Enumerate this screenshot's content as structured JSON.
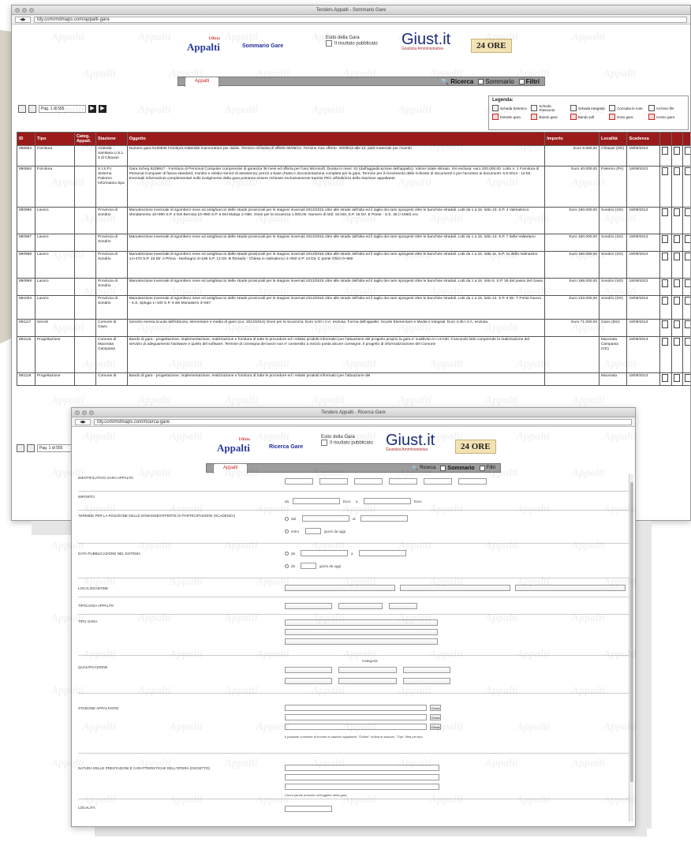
{
  "win1": {
    "title": "Tenders Appalti - Sommario Gare",
    "url": "tdy.com/mdmaps.com/appalti-gara",
    "header": {
      "logo": "Appalti",
      "logo_sub": "Ufficio",
      "sommario_link": "Sommario Gare",
      "esito_title": "Esito della Gara",
      "esito_sub": "Il risultato pubblicato",
      "giust": "Giust.it",
      "giust_sub": "Giustizia Amministrativa",
      "sole": "24 ORE",
      "tab_label": "Appalti",
      "ricerca": "Ricerca",
      "sommario": "Sommario",
      "filtri": "Filtri"
    },
    "pager": {
      "label": "Pag. 1 di 555"
    },
    "legend": {
      "title": "Legenda:",
      "items": [
        "Scheda Sintetica",
        "Scheda Riassunto",
        "Scheda Integrale",
        "Consulta le note",
        "Archivio file",
        "Estratto gara",
        "Bando gara",
        "Bando pdf",
        "Esito gara",
        "Avviso gara"
      ]
    },
    "table": {
      "headers": [
        "ID",
        "Tipo",
        "Categ. Appalt.",
        "Stazione",
        "Oggetto",
        "Importo",
        "Località",
        "Scadenza",
        "",
        "",
        ""
      ],
      "rows": [
        [
          "890854",
          "Fornitura",
          "",
          "Azienda Sanitaria U.S.L. 3 di Chiavari",
          "Numero gara 5190836 Fornitura materiale manovratore per dialisi. Termine richiesta di offerte 05/09/13. Termine max offerte: 30/09/13 alle 12. parti materiale per ricambi",
          "Euro 8.600,00",
          "Chiavari (GE)",
          "19/09/2013"
        ],
        [
          "890864",
          "Fornitura",
          "",
          "S.I.S.P.I. Sistema Palermo Informatica Spa",
          "Gara Scheg 5239917 - Fornitura di Personal Computer comprensivi di garanzia 36 mesi ed offerta per l'uso Microsoft. Durata in mesi: 42 (dall'aggiudicazione dell'appalto). Valore totale stimato, IVA esclusa: euro 200.000,00. Lotto n. 1 Fornitura di Personal Computer di fascia standard, monitor e relativi servizi di assistenza; prezzi a base d'asta e documentazione completa per la gara. Termine per il ricevimento delle richieste di documenti o per l'accesso ai documenti: 6.9.2013 - 12:00. Eventuali informazioni complementari sullo svolgimento della gara potranno essere richieste esclusivamente tramite PEC all'indirizzo della Stazione appaltante.",
          "Euro 40.000,00",
          "Palermo (PA)",
          "19/09/2013"
        ],
        [
          "890996",
          "Lavoro",
          "",
          "Provincia di Sondrio",
          "Manutenzione invernale di sgombero neve ed antighiaccio delle strade provinciali per le stagioni invernali 2013/2015 oltre alle strade dell'alta ed il taglio dei rami sporgenti oltre le banchine stradali. Lotti da 1 a 15. lotto 10. S.P. 4 Valmalenco sfondamento 10+990 S.P. 4 Del Bernina 10+990 S.P. 6 Del Maloja 1+090. Oneri per la sicurezza 1.000,00. Numero di lotti: 15 lotti. S.P. 15 Dir. E Ponte - S.S. 38 (+1960) ecc.",
          "Euro 180.000,00",
          "Sondrio (SO)",
          "19/09/2013"
        ],
        [
          "890997",
          "Lavoro",
          "",
          "Provincia di Sondrio",
          "Manutenzione invernale di sgombero neve ed antighiaccio delle strade provinciali per le stagioni invernali 2013/2015 oltre alle strade dell'alta ed il taglio dei rami sporgenti oltre le banchine stradali. Lotti da 1 a 15. lotto 13. S.P. 7 della Valtartano",
          "Euro 160.000,00",
          "Sondrio (SO)",
          "19/09/2013"
        ],
        [
          "890998",
          "Lavoro",
          "",
          "Provincia di Sondrio",
          "Manutenzione invernale di sgombero neve ed antighiaccio delle strade provinciali per le stagioni invernali 2013/2015 oltre alle strade dell'alta ed il taglio dei rami sporgenti oltre le banchine stradali. Lotti da 1 a 15. lotto 11. S.P. 11 della Valmasino 14+470 S.P. 15 Dir. A Prima - Morbegno 3+186 S.P. 12 Dir. B Tornado - Chiesa in Valmalenco 4+050 S.P. 13 Dir. C ponte Ghiro 0+980",
          "Euro 150.000,00",
          "Sondrio (SO)",
          "19/09/2013"
        ],
        [
          "890999",
          "Lavoro",
          "",
          "Provincia di Sondrio",
          "Manutenzione invernale di sgombero neve ed antighiaccio delle strade provinciali per le stagioni invernali 2013/2015 oltre alle strade dell'alta ed il taglio dei rami sporgenti oltre le banchine stradali. Lotti da 1 a 15. lotto 6. S.P. 29 del passo del Gavia",
          "Euro 198.000,00",
          "Sondrio (SO)",
          "19/09/2013"
        ],
        [
          "891003",
          "Lavoro",
          "",
          "Provincia di Sondrio",
          "Manutenzione invernale di sgombero neve ed antighiaccio delle strade provinciali per le stagioni invernali 2013/2015 oltre alle strade dell'alta ed il taglio dei rami sporgenti oltre le banchine stradali. Lotti da 1 a 15. lotto 12. S.P. 9 Dir. T Ponte Nuovo - S.S. Spluga 1+100 S.P. 9 dei Monastero 3+567",
          "Euro 133.000,00",
          "Sondrio (SO)",
          "19/09/2013"
        ],
        [
          "891117",
          "Servizi",
          "",
          "Comune di Giaro",
          "Servizio mensa scuola dell'infanzia, elementare e media di giaro (a.s. 2013/2014) Oneri per la sicurezza: Euro 4,00 I.V.A. esclusa. Forma dell'appalto: Scuole Elementare e Media e Integrati: Euro 4,45 I.V.A. esclusa.",
          "Euro 71.000,00",
          "Giaro (MU)",
          "19/09/2013"
        ],
        [
          "891118",
          "Progettazione",
          "",
          "Comune di Macerata Campania",
          "Bando di gara - progettazione, implementazione, realizzazione e fornitura di tutte le procedure ed i relativi prodotti informatici per l'attuazione del progetto proprio la gara e' suddiviso in n.8 lotti. Il secondo lotto comprende la realizzazione del servizio di adeguamento hardware e quello del software. Termine di consegna dei lavori non e' consentito a mezzo posta alcune consegne. Il progetto di informatizzazione del Comune",
          "",
          "Macerata Campania (CE)",
          "19/09/2013"
        ],
        [
          "891119",
          "Progettazione",
          "",
          "Comune di",
          "Bando di gara - progettazione, implementazione, realizzazione e fornitura di tutte le procedure ed i relativi prodotti informatici per l'attuazione del",
          "",
          "Macerata",
          "19/09/2013"
        ]
      ]
    },
    "pager2": {
      "label": "Pag. 1 di 555"
    }
  },
  "win2": {
    "title": "Tenders Appalti - Ricerca Gare",
    "url": "tdy.com/mdmaps.com/ricerca-gare",
    "header": {
      "logo": "Appalti",
      "logo_sub": "Ufficio",
      "ricerca_link": "Ricerca Gare",
      "esito_title": "Esito della Gara",
      "esito_sub": "Il risultato pubblicato",
      "giust": "Giust.it",
      "giust_sub": "Giustizia Amministrativa",
      "sole": "24 ORE",
      "tab_label": "Appalti",
      "ricerca": "Ricerca",
      "sommario": "Sommario",
      "filtri": "Filtri"
    },
    "form": {
      "id_label": "Identificativo gara appalto",
      "importo_label": "Importo",
      "importo_da": "da",
      "importo_a": "a",
      "euro": "Euro",
      "termine_label": "Termine per la ricezione delle domande/offerte di partecipazione (Scadenza)",
      "dal": "dal",
      "al": "al",
      "entro": "entro",
      "giorni": "giorni da oggi",
      "data_pub_label": "Data pubblicazione nel sistema",
      "da": "da",
      "localizzazione_label": "Localizzazione",
      "tipologia_label": "Tipologia appalto",
      "tipo_gara_label": "Tipo gara",
      "qualificazione_label": "Qualificazione",
      "categoria": "Categoria",
      "stazione_label": "Stazione appaltante",
      "stazione_note": "Il pulsante consente di trovare le stazioni appaltanti: \"Ordine\" ordina le stazioni, \"Tipo\" filtra per tipo",
      "natura_label": "Natura delle prestazioni e caratteristiche dell'opera (Oggetto)",
      "natura_note": "Cerca parole presenti nell'oggetto della gara",
      "localita_label": "Località",
      "cerca_btn": "Cerca"
    }
  },
  "watermark": "Appalti"
}
